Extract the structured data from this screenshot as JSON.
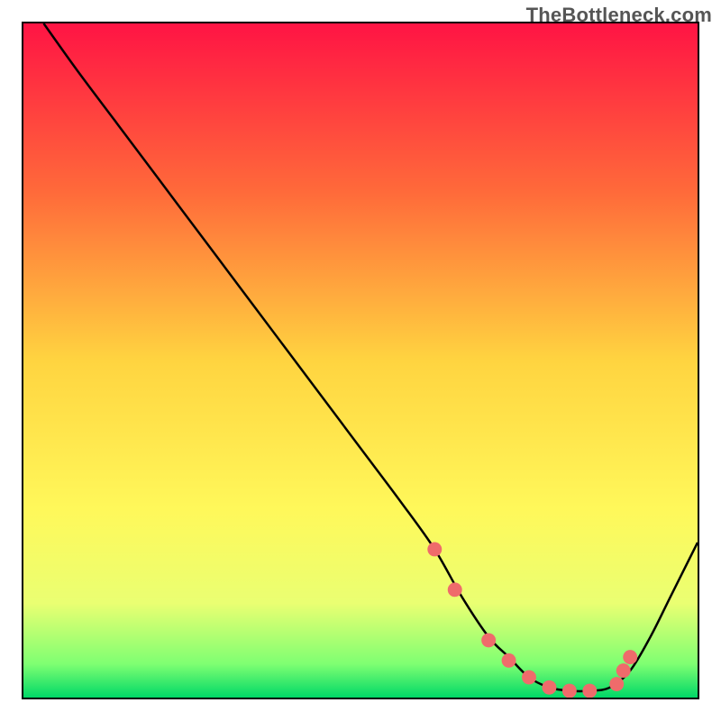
{
  "watermark": "TheBottleneck.com",
  "chart_data": {
    "type": "line",
    "title": "",
    "xlabel": "",
    "ylabel": "",
    "xlim": [
      0,
      100
    ],
    "ylim": [
      0,
      100
    ],
    "gradient_stops": [
      {
        "offset": 0,
        "color": "#ff1444"
      },
      {
        "offset": 0.25,
        "color": "#ff6a3a"
      },
      {
        "offset": 0.5,
        "color": "#ffd440"
      },
      {
        "offset": 0.72,
        "color": "#fff85a"
      },
      {
        "offset": 0.86,
        "color": "#eaff72"
      },
      {
        "offset": 0.95,
        "color": "#7fff72"
      },
      {
        "offset": 1.0,
        "color": "#00d867"
      }
    ],
    "series": [
      {
        "name": "bottleneck-curve",
        "x": [
          3,
          8,
          14,
          20,
          26,
          32,
          38,
          44,
          50,
          56,
          61,
          65,
          69,
          72,
          75,
          78,
          81,
          84,
          87,
          90,
          93,
          96,
          100
        ],
        "y": [
          100,
          93,
          85,
          77,
          69,
          61,
          53,
          45,
          37,
          29,
          22,
          15,
          9,
          6,
          3,
          1.5,
          1,
          1,
          1.5,
          4,
          9,
          15,
          23
        ]
      }
    ],
    "markers": {
      "name": "highlight-dots",
      "color": "#ef6b6b",
      "x": [
        61,
        64,
        69,
        72,
        75,
        78,
        81,
        84,
        88,
        89,
        90
      ],
      "y": [
        22,
        16,
        8.5,
        5.5,
        3,
        1.5,
        1,
        1,
        2,
        4,
        6
      ]
    }
  }
}
